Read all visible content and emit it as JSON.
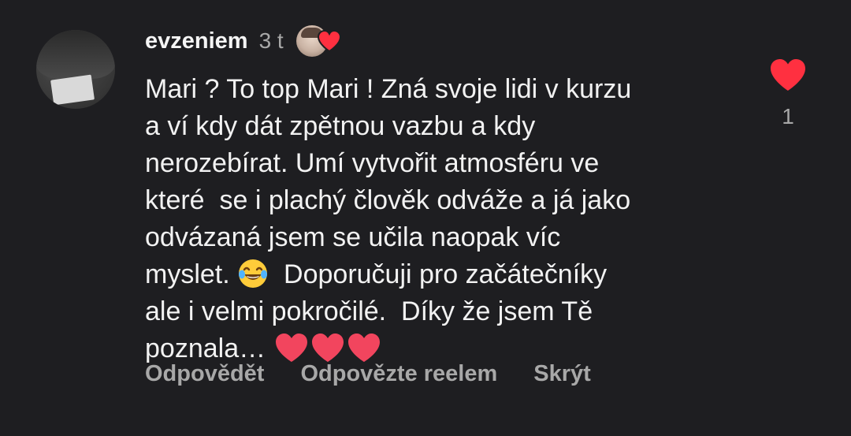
{
  "comment": {
    "username": "evzeniem",
    "time": "3 t",
    "lines": [
      "Mari ? To top Mari ! Zná svoje lidi v kurzu",
      "a ví kdy dát zpětnou vazbu a kdy",
      "nerozebírat. Umí vytvořit atmosféru ve",
      "které  se i plachý člověk odváže a já jako",
      "odvázaná jsem se učila naopak víc",
      "myslet.",
      "Doporučuji pro začátečníky",
      "ale i velmi pokročilé.  Díky že jsem Tě",
      "poznala…"
    ],
    "likes": "1"
  },
  "actions": {
    "reply": "Odpovědět",
    "reel_reply": "Odpovězte reelem",
    "hide": "Skrýt"
  },
  "icons": {
    "avatar": "user-avatar",
    "creator_liked": "creator-liked-heart-icon",
    "like": "heart-icon",
    "laugh_emoji": "face-with-tears-of-joy-emoji",
    "heart_emoji": "red-heart-emoji"
  },
  "colors": {
    "background": "#1e1e21",
    "text": "#f2f2f2",
    "muted": "#a8a8a8",
    "heart": "#ff3040"
  }
}
